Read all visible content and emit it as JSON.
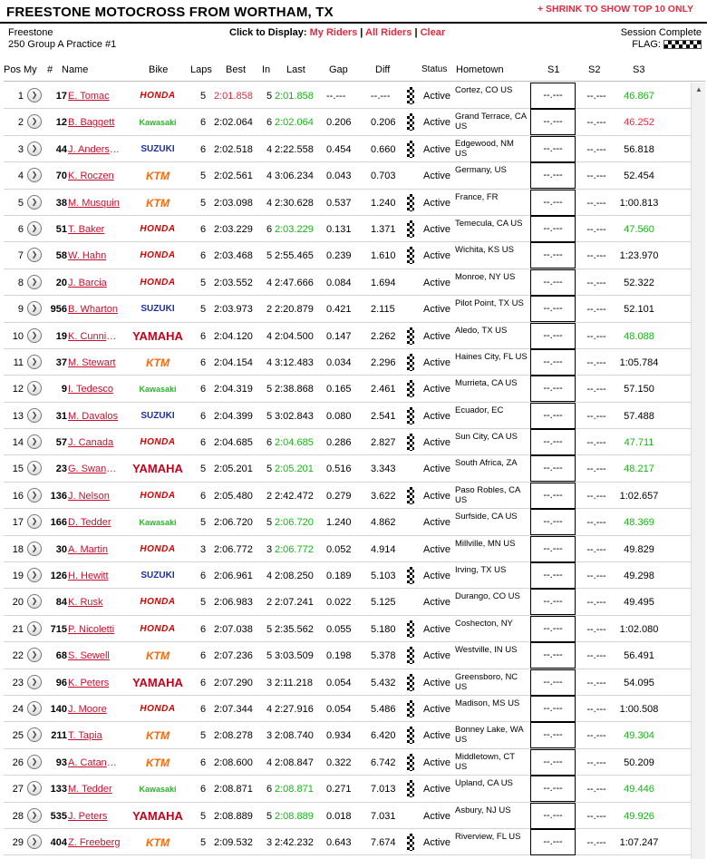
{
  "header": {
    "title": "FREESTONE MOTOCROSS FROM WORTHAM, TX",
    "shrink_link": "+ SHRINK TO SHOW TOP 10 ONLY"
  },
  "info": {
    "venue": "Freestone",
    "session": "250 Group A Practice #1",
    "display_label": "Click to Display:",
    "my_riders": "My Riders",
    "all_riders": "All Riders",
    "clear": "Clear",
    "sep": "|",
    "status": "Session Complete",
    "flag_label": "FLAG:"
  },
  "columns": [
    "Pos",
    "My",
    "#",
    "Name",
    "Bike",
    "Laps",
    "Best",
    "In",
    "Last",
    "Gap",
    "Diff",
    "Status",
    "Hometown",
    "S1",
    "S2",
    "S3"
  ],
  "rows": [
    {
      "pos": "1",
      "num": "17",
      "name": "E. Tomac",
      "bike": "HONDA",
      "bk": "honda",
      "laps": "5",
      "best": "2:01.858",
      "bestc": "red",
      "in": "5",
      "last": "2:01.858",
      "lastc": "green",
      "gap": "--.---",
      "diff": "--.---",
      "flag": true,
      "status": "Active",
      "home": "Cortez, CO US",
      "s1": "--.---",
      "s2": "--.---",
      "s3": "46.867",
      "s3c": "green"
    },
    {
      "pos": "2",
      "num": "12",
      "name": "B. Baggett",
      "bike": "Kawasaki",
      "bk": "kawasaki",
      "laps": "6",
      "best": "2:02.064",
      "bestc": "",
      "in": "6",
      "last": "2:02.064",
      "lastc": "green",
      "gap": "0.206",
      "diff": "0.206",
      "flag": true,
      "status": "Active",
      "home": "Grand Terrace, CA US",
      "s1": "--.---",
      "s2": "--.---",
      "s3": "46.252",
      "s3c": "red"
    },
    {
      "pos": "3",
      "num": "44",
      "name": "J. Anderson",
      "bike": "SUZUKI",
      "bk": "suzuki",
      "laps": "6",
      "best": "2:02.518",
      "bestc": "",
      "in": "4",
      "last": "2:22.558",
      "lastc": "",
      "gap": "0.454",
      "diff": "0.660",
      "flag": true,
      "status": "Active",
      "home": "Edgewood, NM US",
      "s1": "--.---",
      "s2": "--.---",
      "s3": "56.818",
      "s3c": ""
    },
    {
      "pos": "4",
      "num": "70",
      "name": "K. Roczen",
      "bike": "KTM",
      "bk": "ktm",
      "laps": "5",
      "best": "2:02.561",
      "bestc": "",
      "in": "4",
      "last": "3:06.234",
      "lastc": "",
      "gap": "0.043",
      "diff": "0.703",
      "flag": false,
      "status": "Active",
      "home": "Germany, US",
      "s1": "--.---",
      "s2": "--.---",
      "s3": "52.454",
      "s3c": ""
    },
    {
      "pos": "5",
      "num": "38",
      "name": "M. Musquin",
      "bike": "KTM",
      "bk": "ktm",
      "laps": "5",
      "best": "2:03.098",
      "bestc": "",
      "in": "4",
      "last": "2:30.628",
      "lastc": "",
      "gap": "0.537",
      "diff": "1.240",
      "flag": true,
      "status": "Active",
      "home": "France, FR",
      "s1": "--.---",
      "s2": "--.---",
      "s3": "1:00.813",
      "s3c": ""
    },
    {
      "pos": "6",
      "num": "51",
      "name": "T. Baker",
      "bike": "HONDA",
      "bk": "honda",
      "laps": "6",
      "best": "2:03.229",
      "bestc": "",
      "in": "6",
      "last": "2:03.229",
      "lastc": "green",
      "gap": "0.131",
      "diff": "1.371",
      "flag": true,
      "status": "Active",
      "home": "Temecula, CA US",
      "s1": "--.---",
      "s2": "--.---",
      "s3": "47.560",
      "s3c": "green"
    },
    {
      "pos": "7",
      "num": "58",
      "name": "W. Hahn",
      "bike": "HONDA",
      "bk": "honda",
      "laps": "6",
      "best": "2:03.468",
      "bestc": "",
      "in": "5",
      "last": "2:55.465",
      "lastc": "",
      "gap": "0.239",
      "diff": "1.610",
      "flag": true,
      "status": "Active",
      "home": "Wichita, KS US",
      "s1": "--.---",
      "s2": "--.---",
      "s3": "1:23.970",
      "s3c": ""
    },
    {
      "pos": "8",
      "num": "20",
      "name": "J. Barcia",
      "bike": "HONDA",
      "bk": "honda",
      "laps": "5",
      "best": "2:03.552",
      "bestc": "",
      "in": "4",
      "last": "2:47.666",
      "lastc": "",
      "gap": "0.084",
      "diff": "1.694",
      "flag": false,
      "status": "Active",
      "home": "Monroe, NY US",
      "s1": "--.---",
      "s2": "--.---",
      "s3": "52.322",
      "s3c": ""
    },
    {
      "pos": "9",
      "num": "956",
      "name": "B. Wharton",
      "bike": "SUZUKI",
      "bk": "suzuki",
      "laps": "5",
      "best": "2:03.973",
      "bestc": "",
      "in": "2",
      "last": "2:20.879",
      "lastc": "",
      "gap": "0.421",
      "diff": "2.115",
      "flag": false,
      "status": "Active",
      "home": "Pilot Point, TX US",
      "s1": "--.---",
      "s2": "--.---",
      "s3": "52.101",
      "s3c": ""
    },
    {
      "pos": "10",
      "num": "19",
      "name": "K. Cunning...",
      "bike": "YAMAHA",
      "bk": "yamaha",
      "laps": "6",
      "best": "2:04.120",
      "bestc": "",
      "in": "4",
      "last": "2:04.500",
      "lastc": "",
      "gap": "0.147",
      "diff": "2.262",
      "flag": true,
      "status": "Active",
      "home": "Aledo, TX US",
      "s1": "--.---",
      "s2": "--.---",
      "s3": "48.088",
      "s3c": "green"
    },
    {
      "pos": "11",
      "num": "37",
      "name": "M. Stewart",
      "bike": "KTM",
      "bk": "ktm",
      "laps": "6",
      "best": "2:04.154",
      "bestc": "",
      "in": "4",
      "last": "3:12.483",
      "lastc": "",
      "gap": "0.034",
      "diff": "2.296",
      "flag": true,
      "status": "Active",
      "home": "Haines City, FL US",
      "s1": "--.---",
      "s2": "--.---",
      "s3": "1:05.784",
      "s3c": ""
    },
    {
      "pos": "12",
      "num": "9",
      "name": "I. Tedesco",
      "bike": "Kawasaki",
      "bk": "kawasaki",
      "laps": "6",
      "best": "2:04.319",
      "bestc": "",
      "in": "5",
      "last": "2:38.868",
      "lastc": "",
      "gap": "0.165",
      "diff": "2.461",
      "flag": true,
      "status": "Active",
      "home": "Murrieta, CA US",
      "s1": "--.---",
      "s2": "--.---",
      "s3": "57.150",
      "s3c": ""
    },
    {
      "pos": "13",
      "num": "31",
      "name": "M. Davalos",
      "bike": "SUZUKI",
      "bk": "suzuki",
      "laps": "6",
      "best": "2:04.399",
      "bestc": "",
      "in": "5",
      "last": "3:02.843",
      "lastc": "",
      "gap": "0.080",
      "diff": "2.541",
      "flag": true,
      "status": "Active",
      "home": "Ecuador, EC",
      "s1": "--.---",
      "s2": "--.---",
      "s3": "57.488",
      "s3c": ""
    },
    {
      "pos": "14",
      "num": "57",
      "name": "J. Canada",
      "bike": "HONDA",
      "bk": "honda",
      "laps": "6",
      "best": "2:04.685",
      "bestc": "",
      "in": "6",
      "last": "2:04.685",
      "lastc": "green",
      "gap": "0.286",
      "diff": "2.827",
      "flag": true,
      "status": "Active",
      "home": "Sun City, CA US",
      "s1": "--.---",
      "s2": "--.---",
      "s3": "47.711",
      "s3c": "green"
    },
    {
      "pos": "15",
      "num": "23",
      "name": "G. Swanep...",
      "bike": "YAMAHA",
      "bk": "yamaha",
      "laps": "5",
      "best": "2:05.201",
      "bestc": "",
      "in": "5",
      "last": "2:05.201",
      "lastc": "green",
      "gap": "0.516",
      "diff": "3.343",
      "flag": false,
      "status": "Active",
      "home": "South Africa, ZA",
      "s1": "--.---",
      "s2": "--.---",
      "s3": "48.217",
      "s3c": "green"
    },
    {
      "pos": "16",
      "num": "136",
      "name": "J. Nelson",
      "bike": "HONDA",
      "bk": "honda",
      "laps": "6",
      "best": "2:05.480",
      "bestc": "",
      "in": "2",
      "last": "2:42.472",
      "lastc": "",
      "gap": "0.279",
      "diff": "3.622",
      "flag": true,
      "status": "Active",
      "home": "Paso Robles, CA US",
      "s1": "--.---",
      "s2": "--.---",
      "s3": "1:02.657",
      "s3c": ""
    },
    {
      "pos": "17",
      "num": "166",
      "name": "D. Tedder",
      "bike": "Kawasaki",
      "bk": "kawasaki",
      "laps": "5",
      "best": "2:06.720",
      "bestc": "",
      "in": "5",
      "last": "2:06.720",
      "lastc": "green",
      "gap": "1.240",
      "diff": "4.862",
      "flag": false,
      "status": "Active",
      "home": "Surfside, CA US",
      "s1": "--.---",
      "s2": "--.---",
      "s3": "48.369",
      "s3c": "green"
    },
    {
      "pos": "18",
      "num": "30",
      "name": "A. Martin",
      "bike": "HONDA",
      "bk": "honda",
      "laps": "3",
      "best": "2:06.772",
      "bestc": "",
      "in": "3",
      "last": "2:06.772",
      "lastc": "green",
      "gap": "0.052",
      "diff": "4.914",
      "flag": false,
      "status": "Active",
      "home": "Millville, MN US",
      "s1": "--.---",
      "s2": "--.---",
      "s3": "49.829",
      "s3c": ""
    },
    {
      "pos": "19",
      "num": "126",
      "name": "H. Hewitt",
      "bike": "SUZUKI",
      "bk": "suzuki",
      "laps": "6",
      "best": "2:06.961",
      "bestc": "",
      "in": "4",
      "last": "2:08.250",
      "lastc": "",
      "gap": "0.189",
      "diff": "5.103",
      "flag": true,
      "status": "Active",
      "home": "Irving, TX US",
      "s1": "--.---",
      "s2": "--.---",
      "s3": "49.298",
      "s3c": ""
    },
    {
      "pos": "20",
      "num": "84",
      "name": "K. Rusk",
      "bike": "HONDA",
      "bk": "honda",
      "laps": "5",
      "best": "2:06.983",
      "bestc": "",
      "in": "2",
      "last": "2:07.241",
      "lastc": "",
      "gap": "0.022",
      "diff": "5.125",
      "flag": false,
      "status": "Active",
      "home": "Durango, CO US",
      "s1": "--.---",
      "s2": "--.---",
      "s3": "49.495",
      "s3c": ""
    },
    {
      "pos": "21",
      "num": "715",
      "name": "P. Nicoletti",
      "bike": "HONDA",
      "bk": "honda",
      "laps": "6",
      "best": "2:07.038",
      "bestc": "",
      "in": "5",
      "last": "2:35.562",
      "lastc": "",
      "gap": "0.055",
      "diff": "5.180",
      "flag": true,
      "status": "Active",
      "home": "Coshecton, NY",
      "s1": "--.---",
      "s2": "--.---",
      "s3": "1:02.080",
      "s3c": ""
    },
    {
      "pos": "22",
      "num": "68",
      "name": "S. Sewell",
      "bike": "KTM",
      "bk": "ktm",
      "laps": "6",
      "best": "2:07.236",
      "bestc": "",
      "in": "5",
      "last": "3:03.509",
      "lastc": "",
      "gap": "0.198",
      "diff": "5.378",
      "flag": true,
      "status": "Active",
      "home": "Westville, IN US",
      "s1": "--.---",
      "s2": "--.---",
      "s3": "56.491",
      "s3c": ""
    },
    {
      "pos": "23",
      "num": "96",
      "name": "K. Peters",
      "bike": "YAMAHA",
      "bk": "yamaha",
      "laps": "6",
      "best": "2:07.290",
      "bestc": "",
      "in": "3",
      "last": "2:11.218",
      "lastc": "",
      "gap": "0.054",
      "diff": "5.432",
      "flag": true,
      "status": "Active",
      "home": "Greensboro, NC US",
      "s1": "--.---",
      "s2": "--.---",
      "s3": "54.095",
      "s3c": ""
    },
    {
      "pos": "24",
      "num": "140",
      "name": "J. Moore",
      "bike": "HONDA",
      "bk": "honda",
      "laps": "6",
      "best": "2:07.344",
      "bestc": "",
      "in": "4",
      "last": "2:27.916",
      "lastc": "",
      "gap": "0.054",
      "diff": "5.486",
      "flag": true,
      "status": "Active",
      "home": "Madison, MS US",
      "s1": "--.---",
      "s2": "--.---",
      "s3": "1:00.508",
      "s3c": ""
    },
    {
      "pos": "25",
      "num": "211",
      "name": "T. Tapia",
      "bike": "KTM",
      "bk": "ktm",
      "laps": "5",
      "best": "2:08.278",
      "bestc": "",
      "in": "3",
      "last": "2:08.740",
      "lastc": "",
      "gap": "0.934",
      "diff": "6.420",
      "flag": true,
      "status": "Active",
      "home": "Bonney Lake, WA US",
      "s1": "--.---",
      "s2": "--.---",
      "s3": "49.304",
      "s3c": "green"
    },
    {
      "pos": "26",
      "num": "93",
      "name": "A. Catanzaro",
      "bike": "KTM",
      "bk": "ktm",
      "laps": "6",
      "best": "2:08.600",
      "bestc": "",
      "in": "4",
      "last": "2:08.847",
      "lastc": "",
      "gap": "0.322",
      "diff": "6.742",
      "flag": true,
      "status": "Active",
      "home": "Middletown, CT US",
      "s1": "--.---",
      "s2": "--.---",
      "s3": "50.209",
      "s3c": ""
    },
    {
      "pos": "27",
      "num": "133",
      "name": "M. Tedder",
      "bike": "Kawasaki",
      "bk": "kawasaki",
      "laps": "6",
      "best": "2:08.871",
      "bestc": "",
      "in": "6",
      "last": "2:08.871",
      "lastc": "green",
      "gap": "0.271",
      "diff": "7.013",
      "flag": true,
      "status": "Active",
      "home": "Upland, CA US",
      "s1": "--.---",
      "s2": "--.---",
      "s3": "49.446",
      "s3c": "green"
    },
    {
      "pos": "28",
      "num": "535",
      "name": "J. Peters",
      "bike": "YAMAHA",
      "bk": "yamaha",
      "laps": "5",
      "best": "2:08.889",
      "bestc": "",
      "in": "5",
      "last": "2:08.889",
      "lastc": "green",
      "gap": "0.018",
      "diff": "7.031",
      "flag": false,
      "status": "Active",
      "home": "Asbury, NJ US",
      "s1": "--.---",
      "s2": "--.---",
      "s3": "49.926",
      "s3c": "green"
    },
    {
      "pos": "29",
      "num": "404",
      "name": "Z. Freeberg",
      "bike": "KTM",
      "bk": "ktm",
      "laps": "5",
      "best": "2:09.532",
      "bestc": "",
      "in": "3",
      "last": "2:42.232",
      "lastc": "",
      "gap": "0.643",
      "diff": "7.674",
      "flag": true,
      "status": "Active",
      "home": "Riverview, FL US",
      "s1": "--.---",
      "s2": "--.---",
      "s3": "1:07.247",
      "s3c": ""
    }
  ]
}
